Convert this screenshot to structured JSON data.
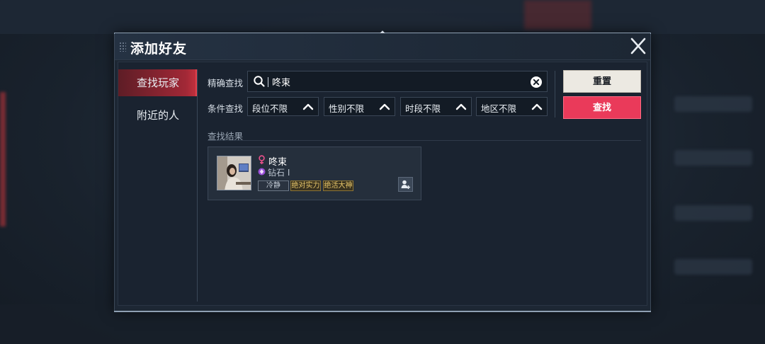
{
  "dialog": {
    "title": "添加好友",
    "sidebar": {
      "items": [
        {
          "label": "查找玩家",
          "active": true
        },
        {
          "label": "附近的人",
          "active": false
        }
      ]
    },
    "search": {
      "exact_label": "精确查找",
      "query": "咚束",
      "filter_label": "条件查找",
      "filters": [
        {
          "value": "段位不限"
        },
        {
          "value": "性别不限"
        },
        {
          "value": "时段不限"
        },
        {
          "value": "地区不限"
        }
      ]
    },
    "buttons": {
      "reset": "重置",
      "search": "查找"
    },
    "results": {
      "label": "查找结果",
      "items": [
        {
          "name": "咚束",
          "rank": "钻石 Ⅰ",
          "tags": [
            "冷静",
            "绝对实力",
            "绝活大神"
          ]
        }
      ]
    }
  },
  "colors": {
    "accent_red": "#ea3a5a",
    "active_tab": "#a12836",
    "gold_tag": "#e8c76a",
    "background": "#1b2430"
  },
  "icons": {
    "close": "close-icon",
    "search": "search-icon",
    "clear": "clear-icon",
    "dropdown": "chevron-up-icon",
    "gender": "female-icon",
    "rank": "diamond-rank-icon",
    "add_friend": "add-friend-icon"
  }
}
